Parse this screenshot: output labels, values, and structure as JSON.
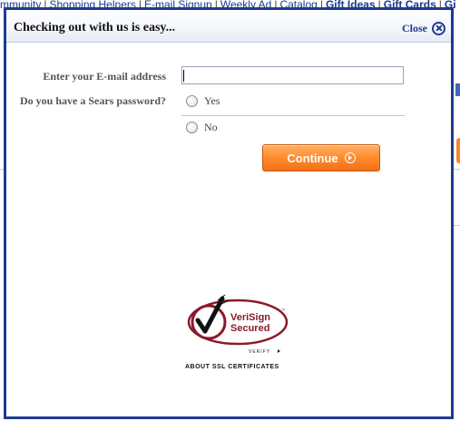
{
  "background_page": {
    "nav_links": [
      "mmunity",
      "Shopping Helpers",
      "E-mail Signup",
      "Weekly Ad",
      "Catalog"
    ],
    "nav_bold_links": [
      "Gift Ideas",
      "Gift Cards",
      "Gi"
    ]
  },
  "modal": {
    "title": "Checking out with us is easy...",
    "close_label": "Close",
    "email": {
      "label": "Enter your E-mail address",
      "value": "",
      "placeholder": ""
    },
    "password_question": {
      "label": "Do you have a Sears password?",
      "options": [
        "Yes",
        "No"
      ]
    },
    "continue_label": "Continue",
    "badge": {
      "line1": "VeriSign",
      "line2": "Secured",
      "verify": "VERIFY",
      "tm": "™"
    },
    "ssl_link": "ABOUT SSL CERTIFICATES"
  },
  "colors": {
    "modal_border": "#1f3a8f",
    "button_orange": "#ff8a2a",
    "verisign_red": "#8b1a2b"
  }
}
